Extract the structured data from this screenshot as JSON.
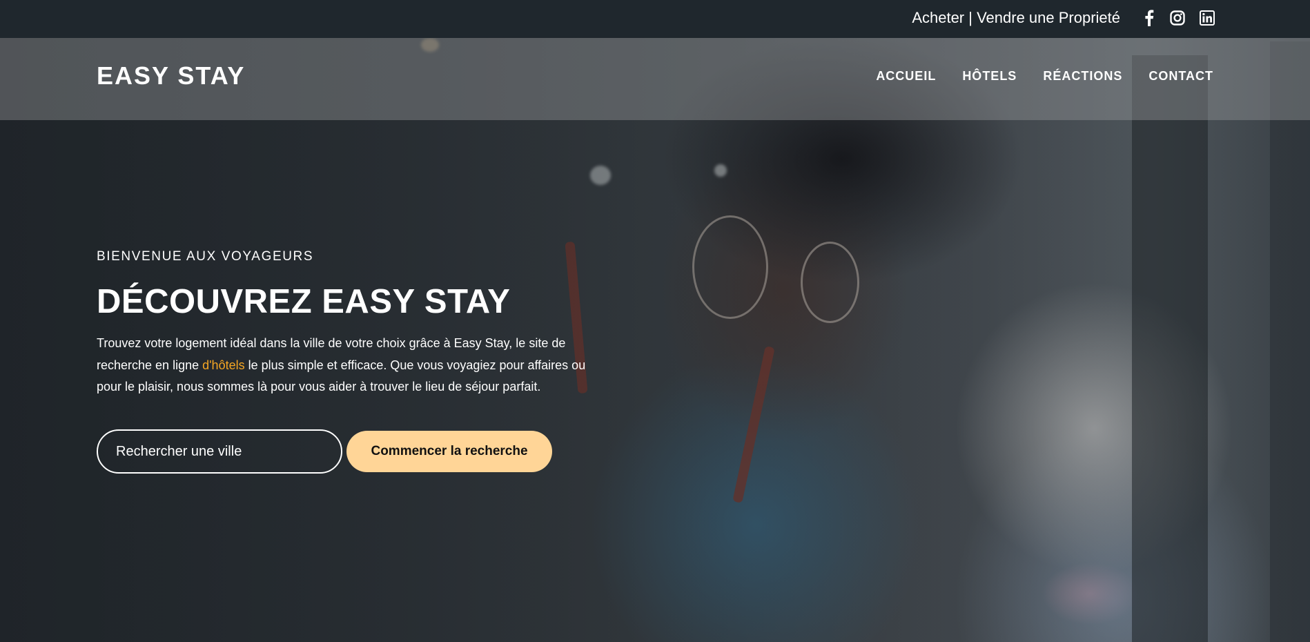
{
  "topbar": {
    "text": "Acheter | Vendre une Proprieté",
    "social_icons": [
      "facebook-icon",
      "instagram-icon",
      "linkedin-icon"
    ]
  },
  "navbar": {
    "logo": "EASY STAY",
    "links": [
      "ACCUEIL",
      "HÔTELS",
      "RÉACTIONS",
      "CONTACT"
    ]
  },
  "hero": {
    "eyebrow": "BIENVENUE AUX VOYAGEURS",
    "headline": "DÉCOUVREZ EASY STAY",
    "description_before": "Trouvez votre logement idéal dans la ville de votre choix grâce à Easy Stay, le site de recherche en ligne ",
    "description_link": "d'hôtels",
    "description_after": " le plus simple et efficace. Que vous voyagiez pour affaires ou pour le plaisir, nous sommes là pour vous aider à trouver le lieu de séjour parfait.",
    "search_placeholder": "Rechercher une ville",
    "search_button": "Commencer la recherche"
  },
  "colors": {
    "topbar_bg": "#1f272d",
    "accent": "#f5a623",
    "button_bg": "#ffd597"
  }
}
